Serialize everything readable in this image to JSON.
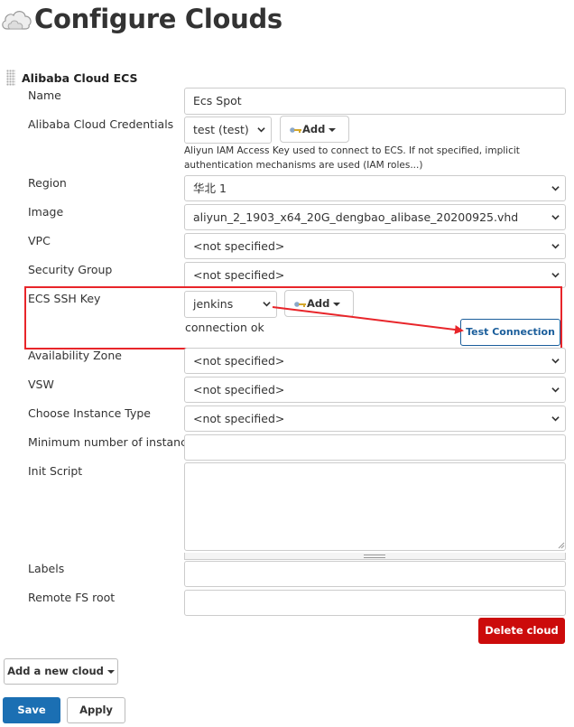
{
  "page": {
    "title": "Configure Clouds",
    "title_icon": "cloud-icon"
  },
  "section": {
    "title": "Alibaba Cloud ECS"
  },
  "labels": {
    "name": "Name",
    "credentials": "Alibaba Cloud Credentials",
    "region": "Region",
    "image": "Image",
    "vpc": "VPC",
    "security_group": "Security Group",
    "ssh_key": "ECS SSH Key",
    "availability_zone": "Availability Zone",
    "vsw": "VSW",
    "instance_type": "Choose Instance Type",
    "min_instances": "Minimum number of instances",
    "init_script": "Init Script",
    "labels": "Labels",
    "remote_fs_root": "Remote FS root"
  },
  "values": {
    "name": "Ecs Spot",
    "credentials": "test (test)",
    "region": "华北 1",
    "image": "aliyun_2_1903_x64_20G_dengbao_alibase_20200925.vhd",
    "vpc": "<not specified>",
    "security_group": "<not specified>",
    "ssh_key": "jenkins",
    "availability_zone": "<not specified>",
    "vsw": "<not specified>",
    "instance_type": "<not specified>",
    "min_instances": "",
    "init_script": "",
    "labels": "",
    "remote_fs_root": ""
  },
  "help": {
    "credentials": "Aliyun IAM Access Key used to connect to ECS. If not specified, implicit authentication mechanisms are used (IAM roles...)"
  },
  "status": {
    "connection": "connection ok"
  },
  "buttons": {
    "add": "Add",
    "test_connection": "Test Connection",
    "delete_cloud": "Delete cloud",
    "add_new_cloud": "Add a new cloud",
    "save": "Save",
    "apply": "Apply"
  },
  "colors": {
    "highlight": "#e8252a",
    "delete": "#cc0b0b",
    "save": "#1b6fb3",
    "test_border": "#1b5e9b"
  }
}
